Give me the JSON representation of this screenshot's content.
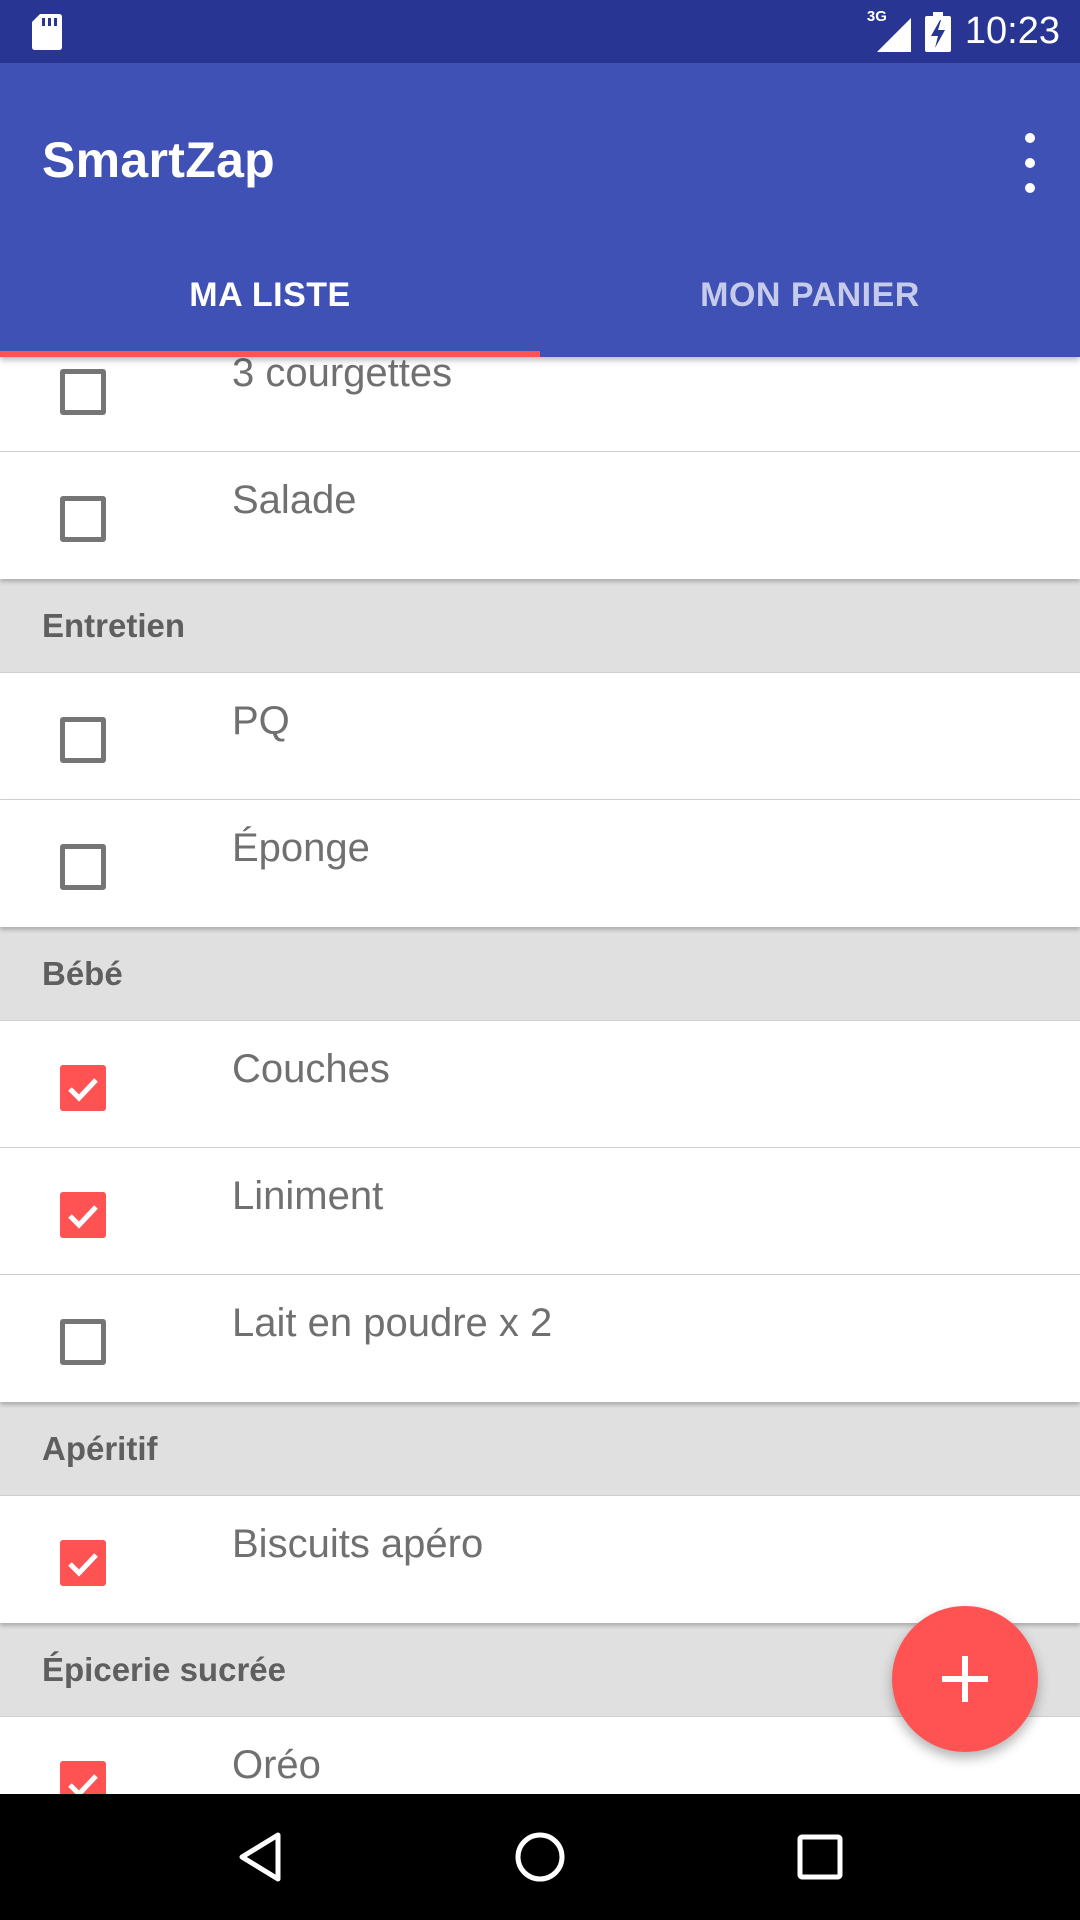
{
  "status_bar": {
    "time": "10:23",
    "network": "3G"
  },
  "app_bar": {
    "title": "SmartZap"
  },
  "tabs": [
    {
      "label": "MA LISTE",
      "active": true
    },
    {
      "label": "MON PANIER",
      "active": false
    }
  ],
  "list": {
    "top_items": [
      {
        "label": "3 courgettes",
        "checked": false
      },
      {
        "label": "Salade",
        "checked": false
      }
    ],
    "sections": [
      {
        "title": "Entretien",
        "items": [
          {
            "label": "PQ",
            "checked": false
          },
          {
            "label": "Éponge",
            "checked": false
          }
        ]
      },
      {
        "title": "Bébé",
        "items": [
          {
            "label": "Couches",
            "checked": true
          },
          {
            "label": "Liniment",
            "checked": true
          },
          {
            "label": "Lait en poudre x 2",
            "checked": false
          }
        ]
      },
      {
        "title": "Apéritif",
        "items": [
          {
            "label": "Biscuits apéro",
            "checked": true
          }
        ]
      },
      {
        "title": "Épicerie sucrée",
        "items": [
          {
            "label": "Oréo",
            "checked": true
          }
        ]
      }
    ]
  },
  "fab": {
    "icon": "plus-icon"
  },
  "colors": {
    "primary": "#3f51b5",
    "primary_dark": "#283593",
    "accent": "#ff5252",
    "section_bg": "#e0e0e0"
  }
}
